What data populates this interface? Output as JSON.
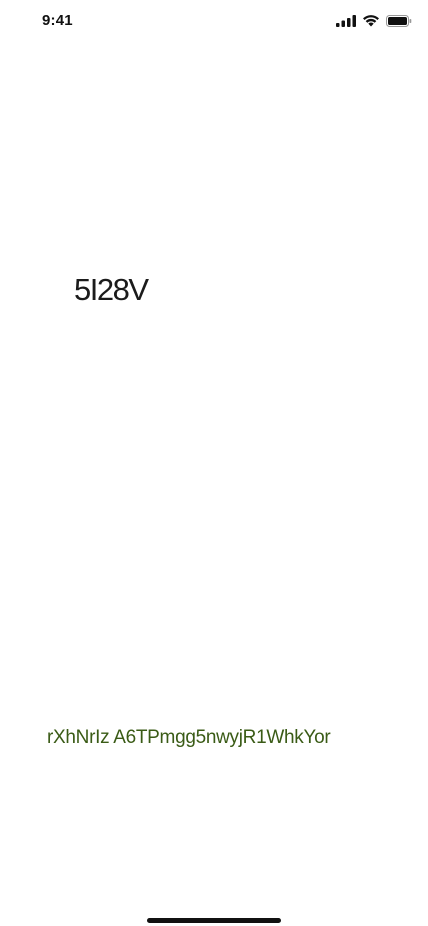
{
  "status_bar": {
    "time": "9:41",
    "icons": [
      "signal-icon",
      "wifi-icon",
      "battery-icon"
    ]
  },
  "main": {
    "headline": "5I28V",
    "link_text": "rXhNrIz A6TPmgg5nwyjR1WhkYor"
  },
  "colors": {
    "background": "#ffffff",
    "headline": "#1b1b1b",
    "link_text": "#3a5b16",
    "home_indicator": "#111111"
  }
}
